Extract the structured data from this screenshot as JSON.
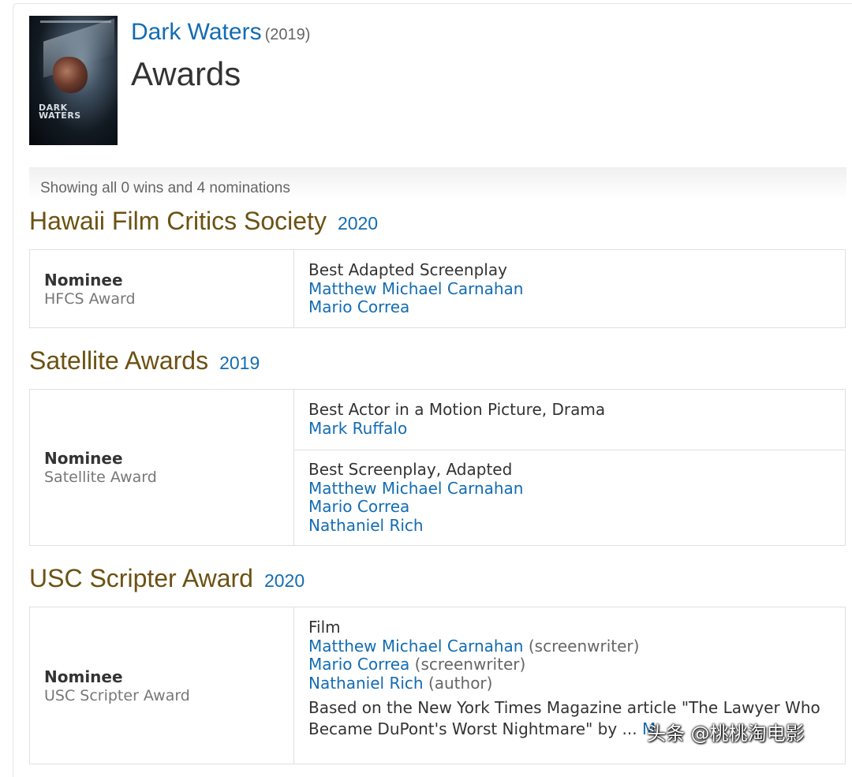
{
  "movie": {
    "title": "Dark Waters",
    "year": "(2019)",
    "poster_text": "DARK WATERS"
  },
  "page_title": "Awards",
  "summary": "Showing all 0 wins and 4 nominations",
  "sections": [
    {
      "name": "Hawaii Film Critics Society",
      "year": "2020",
      "outcome": "Nominee",
      "award": "HFCS Award",
      "details": [
        {
          "category": "Best Adapted Screenplay",
          "people": [
            {
              "name": "Matthew Michael Carnahan"
            },
            {
              "name": "Mario Correa"
            }
          ]
        }
      ]
    },
    {
      "name": "Satellite Awards",
      "year": "2019",
      "outcome": "Nominee",
      "award": "Satellite Award",
      "details": [
        {
          "category": "Best Actor in a Motion Picture, Drama",
          "people": [
            {
              "name": "Mark Ruffalo"
            }
          ]
        },
        {
          "category": "Best Screenplay, Adapted",
          "people": [
            {
              "name": "Matthew Michael Carnahan"
            },
            {
              "name": "Mario Correa"
            },
            {
              "name": "Nathaniel Rich"
            }
          ]
        }
      ]
    },
    {
      "name": "USC Scripter Award",
      "year": "2020",
      "outcome": "Nominee",
      "award": "USC Scripter Award",
      "details": [
        {
          "category": "Film",
          "people": [
            {
              "name": "Matthew Michael Carnahan",
              "role": "(screenwriter)"
            },
            {
              "name": "Mario Correa",
              "role": "(screenwriter)"
            },
            {
              "name": "Nathaniel Rich",
              "role": "(author)"
            }
          ],
          "note": "Based on the New York Times Magazine article \"The Lawyer Who Became DuPont's Worst Nightmare\" by ... ",
          "more_link": "M"
        }
      ]
    }
  ],
  "watermark": "头条 @桃桃淘电影"
}
